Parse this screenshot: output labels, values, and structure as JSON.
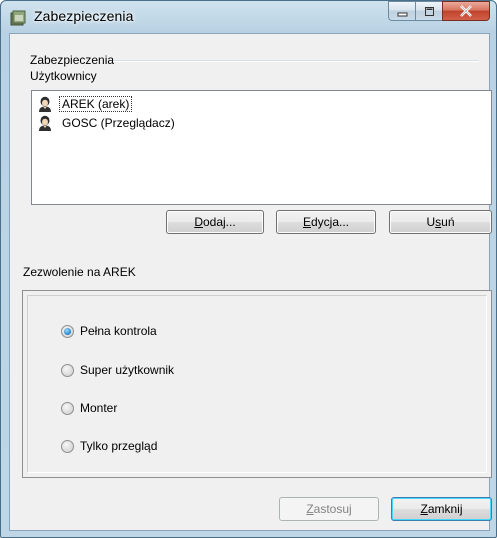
{
  "window": {
    "title": "Zabezpieczenia"
  },
  "security_group": {
    "label": "Zabezpieczenia",
    "users_label": "Użytkownicy",
    "users": [
      {
        "label": "AREK (arek)",
        "selected": true
      },
      {
        "label": "GOSC (Przeglądacz)",
        "selected": false
      }
    ]
  },
  "user_buttons": {
    "add": {
      "mnemonic": "D",
      "rest": "odaj..."
    },
    "edit": {
      "mnemonic": "E",
      "rest": "dycja..."
    },
    "remove": {
      "lead": "U",
      "mnemonic": "s",
      "rest": "uń"
    }
  },
  "permissions": {
    "label": "Zezwolenie na AREK",
    "options": [
      {
        "label": "Pełna kontrola",
        "checked": true
      },
      {
        "label": "Super użytkownik",
        "checked": false
      },
      {
        "label": "Monter",
        "checked": false
      },
      {
        "label": "Tylko przegląd",
        "checked": false
      }
    ]
  },
  "footer": {
    "apply": {
      "mnemonic": "Z",
      "rest": "astosuj",
      "enabled": false
    },
    "close": {
      "mnemonic": "Z",
      "rest": "amknij"
    }
  },
  "colors": {
    "titlebar": "#b9d2e3",
    "close_button": "#c2432c",
    "radio_checked": "#2a8dd4"
  },
  "icons": {
    "app": "security-folder-icon",
    "user": "user-avatar-icon",
    "minimize": "minimize-icon",
    "maximize": "maximize-icon",
    "close": "close-icon"
  }
}
